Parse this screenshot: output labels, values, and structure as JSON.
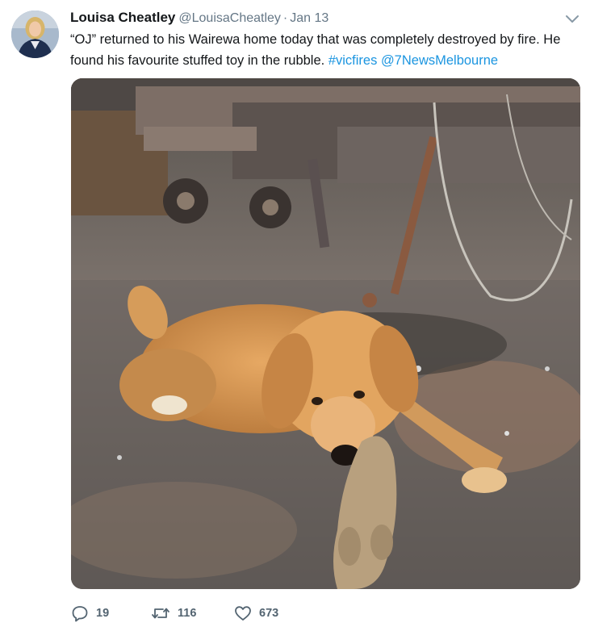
{
  "tweet": {
    "author": {
      "display_name": "Louisa Cheatley",
      "handle": "@LouisaCheatley",
      "avatar": "profile-photo"
    },
    "separator": "·",
    "date": "Jan 13",
    "caret_icon": "chevron-down-icon",
    "text": {
      "part1": "“OJ” returned to his Wairewa home today that was completely destroyed by fire. He found his favourite stuffed toy in the rubble.",
      "hashtag": "#vicfires",
      "mention": "@7NewsMelbourne"
    },
    "media": {
      "type": "photo",
      "subject": "golden-retriever-with-stuffed-toy"
    },
    "actions": {
      "reply": {
        "icon": "reply-icon",
        "count": "19"
      },
      "retweet": {
        "icon": "retweet-icon",
        "count": "116"
      },
      "like": {
        "icon": "heart-icon",
        "count": "673"
      }
    },
    "colors": {
      "link": "#1b95e0",
      "secondary_text": "#657786",
      "primary_text": "#14171a"
    }
  }
}
